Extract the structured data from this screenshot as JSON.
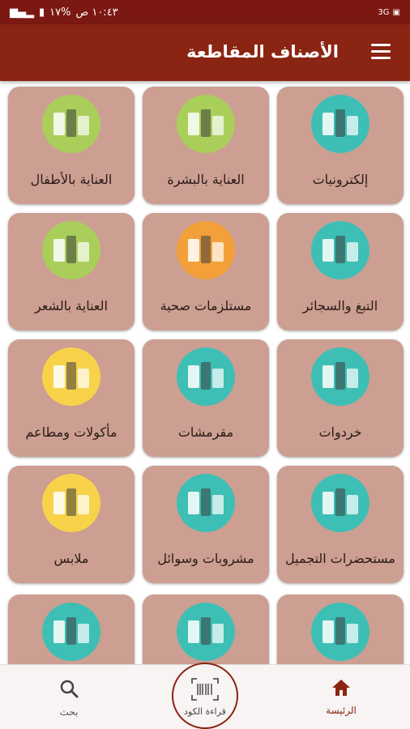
{
  "status_bar": {
    "time": "١٠:٤٣ ص",
    "battery": "%١٧",
    "network": "3G"
  },
  "app_bar": {
    "title": "الأصناف المقاطعة"
  },
  "categories": [
    {
      "label": "إلكترونيات",
      "icon": "electronics-icon",
      "color": "#3dbfb5"
    },
    {
      "label": "العناية بالبشرة",
      "icon": "skincare-icon",
      "color": "#a9cf5a"
    },
    {
      "label": "العناية بالأطفال",
      "icon": "baby-care-icon",
      "color": "#a9cf5a"
    },
    {
      "label": "التبغ والسجائر",
      "icon": "tobacco-icon",
      "color": "#3dbfb5"
    },
    {
      "label": "مستلزمات صحية",
      "icon": "hygiene-icon",
      "color": "#f3a03a"
    },
    {
      "label": "العناية بالشعر",
      "icon": "haircare-icon",
      "color": "#a9cf5a"
    },
    {
      "label": "خردوات",
      "icon": "hardware-icon",
      "color": "#3dbfb5"
    },
    {
      "label": "مقرمشات",
      "icon": "snacks-icon",
      "color": "#3dbfb5"
    },
    {
      "label": "مأكولات ومطاعم",
      "icon": "restaurant-icon",
      "color": "#f8d34a"
    },
    {
      "label": "مستحضرات التجميل",
      "icon": "cosmetics-icon",
      "color": "#3dbfb5"
    },
    {
      "label": "مشروبات وسوائل",
      "icon": "drinks-icon",
      "color": "#3dbfb5"
    },
    {
      "label": "ملابس",
      "icon": "clothes-icon",
      "color": "#f8d34a"
    },
    {
      "label": "",
      "icon": "groceries-icon",
      "color": "#3dbfb5"
    },
    {
      "label": "",
      "icon": "dairy-icon",
      "color": "#3dbfb5"
    },
    {
      "label": "",
      "icon": "detergent-icon",
      "color": "#3dbfb5"
    }
  ],
  "bottom_nav": {
    "home": {
      "label": "الرئيسة",
      "icon": "home-icon"
    },
    "scan": {
      "label": "قراءة الكود",
      "icon": "barcode-scan-icon"
    },
    "search": {
      "label": "بحث",
      "icon": "search-icon"
    }
  }
}
